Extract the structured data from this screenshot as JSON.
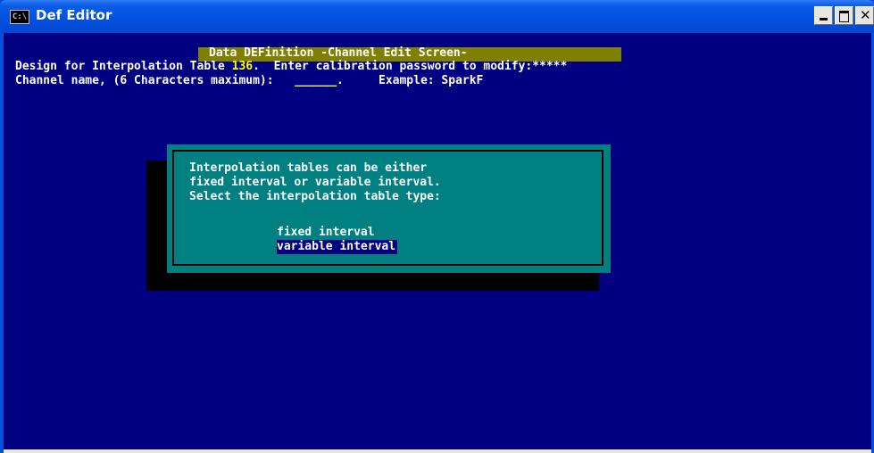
{
  "window": {
    "title": "Def Editor",
    "icon": "console-icon",
    "icon_text": "C:\\",
    "minimize_icon": "minimize-icon",
    "maximize_icon": "maximize-icon",
    "close_glyph": "✕"
  },
  "screen": {
    "header": "Data DEFinition -Channel Edit Screen-",
    "line1_prefix": "Design for Interpolation Table ",
    "table_number": "136",
    "line1_suffix": ".  Enter calibration password to modify:*****",
    "line2": "Channel name, (6 Characters maximum):   ______.     Example: SparkF"
  },
  "dialog": {
    "lines": [
      "Interpolation tables can be either",
      "fixed interval or variable interval.",
      "Select the interpolation table type:"
    ],
    "options": [
      {
        "label": "fixed interval",
        "selected": false
      },
      {
        "label": "variable interval",
        "selected": true
      }
    ]
  },
  "colors": {
    "console_bg": "#000080",
    "header_bg": "#808000",
    "dialog_bg": "#008080",
    "highlight": "#ffff00"
  }
}
